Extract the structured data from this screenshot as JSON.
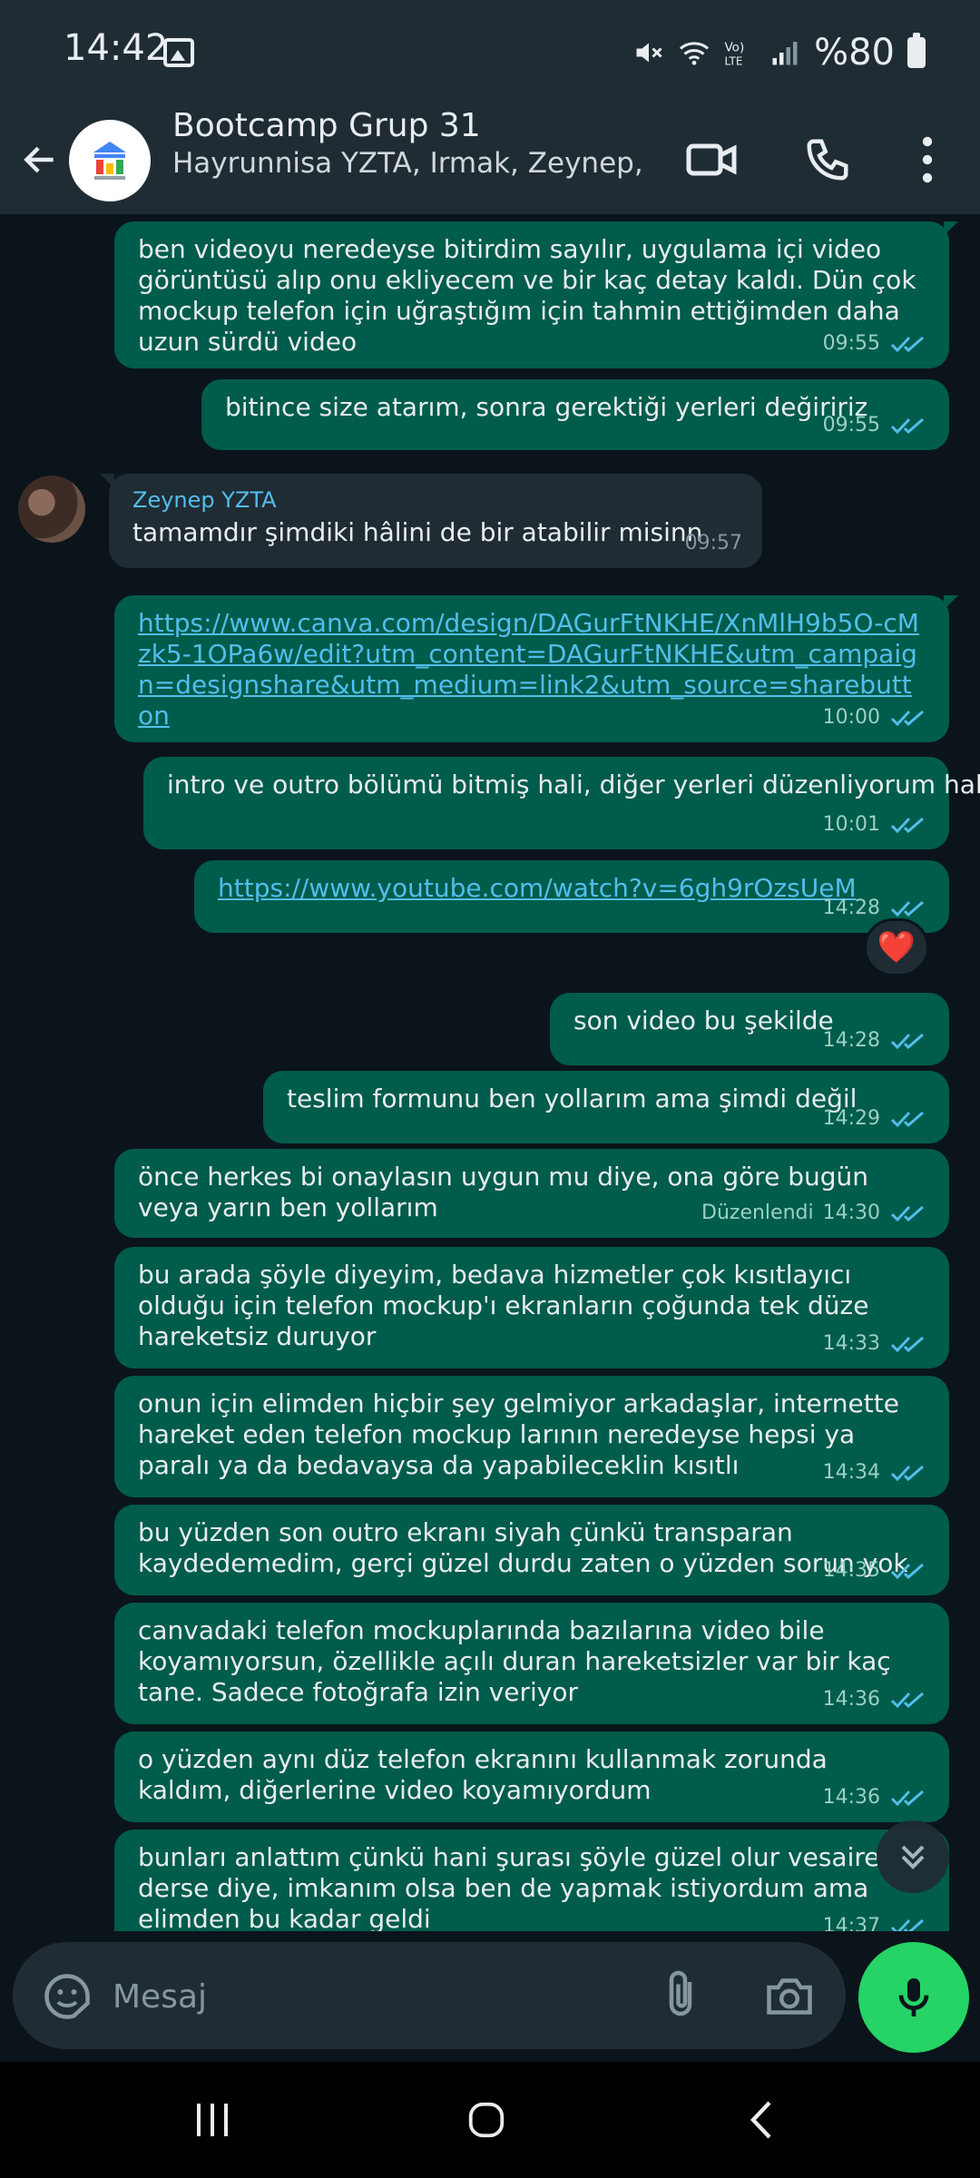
{
  "status_bar": {
    "time": "14:42",
    "battery_text": "%80",
    "icons": [
      "gallery-icon",
      "mute-icon",
      "wifi-icon",
      "volte-icon",
      "signal-icon",
      "battery-icon"
    ]
  },
  "header": {
    "title": "Bootcamp Grup 31",
    "subtitle": "Hayrunnisa YZTA, Irmak, Zeynep, Siz",
    "icons": [
      "back-arrow-icon",
      "video-call-icon",
      "phone-icon",
      "more-vert-icon"
    ]
  },
  "messages": [
    {
      "dir": "out",
      "text": "ben videoyu neredeyse bitirdim sayılır, uygulama içi video görüntüsü alıp onu ekliyecem ve bir kaç detay kaldı. Dün çok mockup telefon için uğraştığım için tahmin ettiğimden daha uzun sürdü video",
      "time": "09:55"
    },
    {
      "dir": "out",
      "text": "bitince size atarım, sonra gerektiği yerleri değiririz",
      "time": "09:55"
    },
    {
      "dir": "in",
      "sender": "Zeynep YZTA",
      "text": "tamamdır şimdiki hâlini de bir atabilir misinn",
      "time": "09:57"
    },
    {
      "dir": "out",
      "text": "https://www.canva.com/design/DAGurFtNKHE/XnMlH9b5O-cMzk5-1OPa6w/edit?utm_content=DAGurFtNKHE&utm_campaign=designshare&utm_medium=link2&utm_source=sharebutton",
      "time": "10:00",
      "link": true
    },
    {
      "dir": "out",
      "text": "intro ve outro bölümü bitmiş hali, diğer yerleri düzenliyorum hala",
      "time": "10:01"
    },
    {
      "dir": "out",
      "text": "https://www.youtube.com/watch?v=6gh9rOzsUeM",
      "time": "14:28",
      "link": true,
      "reaction": "❤️"
    },
    {
      "dir": "out",
      "text": "son video bu şekilde",
      "time": "14:28"
    },
    {
      "dir": "out",
      "text": "teslim formunu ben yollarım ama şimdi değil",
      "time": "14:29"
    },
    {
      "dir": "out",
      "text": "önce herkes bi onaylasın uygun mu diye, ona göre bugün veya yarın ben yollarım",
      "time": "14:30",
      "edited": "Düzenlendi"
    },
    {
      "dir": "out",
      "text": "bu arada şöyle diyeyim, bedava hizmetler çok kısıtlayıcı olduğu için telefon mockup'ı ekranların çoğunda tek düze hareketsiz duruyor",
      "time": "14:33"
    },
    {
      "dir": "out",
      "text": "onun için elimden hiçbir şey gelmiyor arkadaşlar, internette hareket eden telefon mockup larının neredeyse hepsi ya paralı ya da bedavaysa da yapabileceklin kısıtlı",
      "time": "14:34"
    },
    {
      "dir": "out",
      "text": "bu yüzden son outro ekranı siyah çünkü transparan kaydedemedim, gerçi güzel durdu zaten o yüzden sorun yok",
      "time": "14:35"
    },
    {
      "dir": "out",
      "text": "canvadaki telefon mockuplarında bazılarına video bile koyamıyorsun, özellikle açılı duran hareketsizler var bir kaç tane. Sadece fotoğrafa izin veriyor",
      "time": "14:36"
    },
    {
      "dir": "out",
      "text": "o yüzden aynı düz telefon ekranını kullanmak zorunda kaldım, diğerlerine video koyamıyordum",
      "time": "14:36"
    },
    {
      "dir": "out",
      "text": "bunları anlattım çünkü hani şurası şöyle güzel olur vesaire derse diye, imkanım olsa ben de yapmak istiyordum ama elimden bu kadar geldi",
      "time": "14:37"
    }
  ],
  "input": {
    "placeholder": "Mesaj",
    "icons": [
      "sticker-icon",
      "attach-icon",
      "camera-icon",
      "mic-icon"
    ]
  },
  "nav_bar": {
    "icons": [
      "recent-apps-icon",
      "home-icon",
      "back-icon"
    ]
  },
  "colors": {
    "background": "#0b141a",
    "header": "#1f2c34",
    "bubble_out": "#005c4b",
    "bubble_in": "#1f2c34",
    "tick_read": "#53bdeb",
    "mic_green": "#25d366"
  }
}
